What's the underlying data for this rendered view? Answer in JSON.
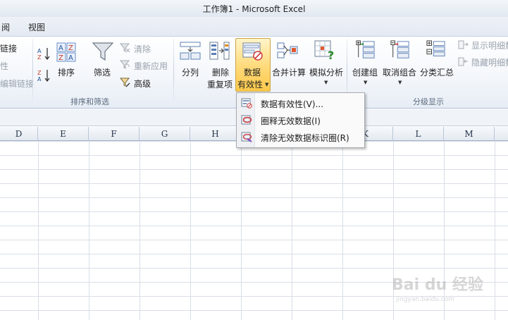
{
  "window": {
    "title": "工作簿1  -  Microsoft Excel"
  },
  "tabs": [
    {
      "label": "阅"
    },
    {
      "label": "视图"
    }
  ],
  "ribbon": {
    "connections": {
      "items": [
        "链接",
        "性",
        "编辑链接"
      ]
    },
    "sort_filter": {
      "sort_label": "排序",
      "filter_label": "筛选",
      "clear_label": "清除",
      "reapply_label": "重新应用",
      "advanced_label": "高级",
      "group_label": "排序和筛选"
    },
    "data_tools": {
      "split_label": "分列",
      "remove_dup_label_1": "删除",
      "remove_dup_label_2": "重复项",
      "validation_label_1": "数据",
      "validation_label_2": "有效性",
      "consolidate_label": "合并计算",
      "whatif_label": "模拟分析"
    },
    "outline": {
      "group_btn_label": "创建组",
      "ungroup_btn_label": "取消组合",
      "subtotal_label": "分类汇总",
      "show_detail_label": "显示明细数",
      "hide_detail_label": "隐藏明细数",
      "group_label": "分级显示"
    }
  },
  "grid": {
    "columns": [
      "D",
      "E",
      "F",
      "G",
      "H",
      "K",
      "L",
      "M"
    ]
  },
  "validation_menu": {
    "items": [
      {
        "label": "数据有效性(V)..."
      },
      {
        "label": "圈释无效数据(I)"
      },
      {
        "label": "清除无效数据标识圈(R)"
      }
    ]
  },
  "watermark": {
    "brand": "Bai du 经验",
    "url": "jingyan.baidu.com"
  },
  "colors": {
    "accent_active": "#ffd978",
    "ribbon_border": "#aebfd4",
    "validation_red": "#d23a3a"
  }
}
